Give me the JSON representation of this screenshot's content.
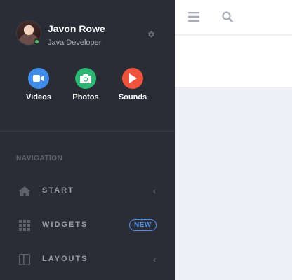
{
  "user": {
    "name": "Javon Rowe",
    "role": "Java Developer",
    "status": "online"
  },
  "media": [
    {
      "label": "Videos",
      "icon": "video-camera-icon",
      "color": "#3f8de8"
    },
    {
      "label": "Photos",
      "icon": "camera-icon",
      "color": "#2bb673"
    },
    {
      "label": "Sounds",
      "icon": "play-icon",
      "color": "#ee5340"
    }
  ],
  "nav": {
    "heading": "NAVIGATION",
    "items": [
      {
        "label": "START",
        "icon": "home-icon",
        "chevron": "‹"
      },
      {
        "label": "WIDGETS",
        "icon": "grid-icon",
        "badge": "NEW"
      },
      {
        "label": "LAYOUTS",
        "icon": "layout-icon",
        "chevron": "‹"
      }
    ]
  },
  "topbar": {
    "icons": [
      "menu-icon",
      "search-icon"
    ]
  },
  "colors": {
    "sidebar_bg": "#2a2d35",
    "accent": "#4f8ff0",
    "status_online": "#4cc15c"
  }
}
